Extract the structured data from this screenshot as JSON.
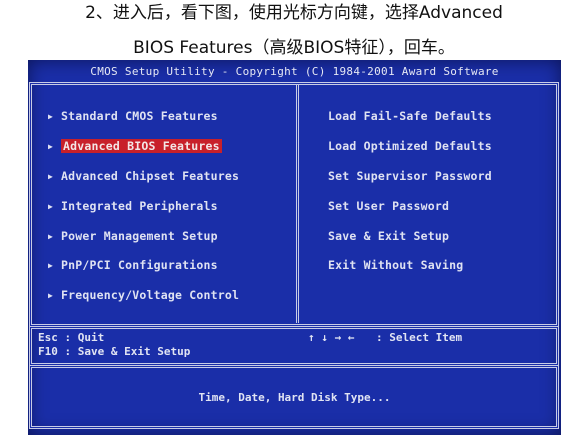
{
  "instruction": {
    "line1": "2、进入后，看下图，使用光标方向键，选择Advanced",
    "line2": "BIOS Features（高级BIOS特征），回车。"
  },
  "bios": {
    "header": "CMOS Setup Utility - Copyright (C) 1984-2001 Award Software",
    "left_menu": [
      "Standard CMOS Features",
      "Advanced BIOS Features",
      "Advanced Chipset Features",
      "Integrated Peripherals",
      "Power Management Setup",
      "PnP/PCI Configurations",
      "Frequency/Voltage Control"
    ],
    "selected_index": 1,
    "right_menu": [
      "Load Fail-Safe Defaults",
      "Load Optimized Defaults",
      "Set Supervisor Password",
      "Set User Password",
      "Save & Exit Setup",
      "Exit Without Saving"
    ],
    "help": {
      "esc": "Esc : Quit",
      "f10": "F10 : Save & Exit Setup",
      "arrows": "↑ ↓ → ←",
      "select": ": Select Item"
    },
    "status": "Time, Date, Hard Disk Type...",
    "colors": {
      "background": "#1a2ea8",
      "text": "#dfe2f2",
      "highlight": "#c8202a"
    }
  }
}
